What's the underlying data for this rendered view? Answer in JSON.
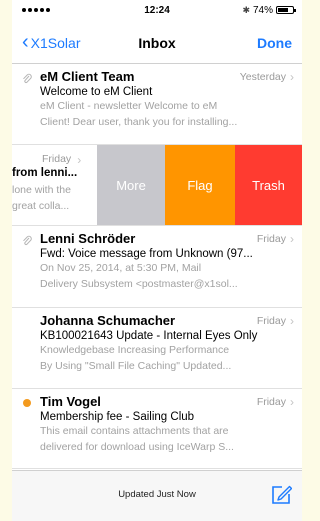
{
  "status_bar": {
    "time": "12:24",
    "battery_pct": "74%",
    "battery_level": 0.74
  },
  "nav": {
    "back_label": "X1Solar",
    "title": "Inbox",
    "done_label": "Done"
  },
  "messages": [
    {
      "sender": "eM Client Team",
      "date": "Yesterday",
      "subject": "Welcome to eM Client",
      "preview_1": "eM Client - newsletter Welcome to eM",
      "preview_2": "Client! Dear user, thank you for installing...",
      "has_attachment": true,
      "unread": false
    },
    {
      "date": "Friday",
      "sender_partial": "from lenni...",
      "preview_1": "lone with the",
      "preview_2": "great colla...",
      "actions": {
        "more": "More",
        "flag": "Flag",
        "trash": "Trash"
      }
    },
    {
      "sender": "Lenni Schröder",
      "date": "Friday",
      "subject": "Fwd: Voice message from Unknown (97...",
      "preview_1": "On Nov 25, 2014, at 5:30 PM, Mail",
      "preview_2": "Delivery Subsystem <postmaster@x1sol...",
      "has_attachment": true,
      "unread": false
    },
    {
      "sender": "Johanna Schumacher",
      "date": "Friday",
      "subject": "KB100021643 Update - Internal Eyes Only",
      "preview_1": "Knowledgebase Increasing Performance",
      "preview_2": "By Using \"Small File Caching\" Updated...",
      "has_attachment": false,
      "unread": false
    },
    {
      "sender": "Tim Vogel",
      "date": "Friday",
      "subject": "Membership fee - Sailing Club",
      "preview_1": "This email contains attachments that are",
      "preview_2": "delivered for download using IceWarp S...",
      "has_attachment": false,
      "unread": true
    }
  ],
  "toolbar": {
    "status": "Updated Just Now"
  },
  "colors": {
    "accent": "#1d7bff",
    "more": "#c7c7cc",
    "flag": "#ff9500",
    "trash": "#ff3b30",
    "unread_dot": "#f39a1e"
  }
}
